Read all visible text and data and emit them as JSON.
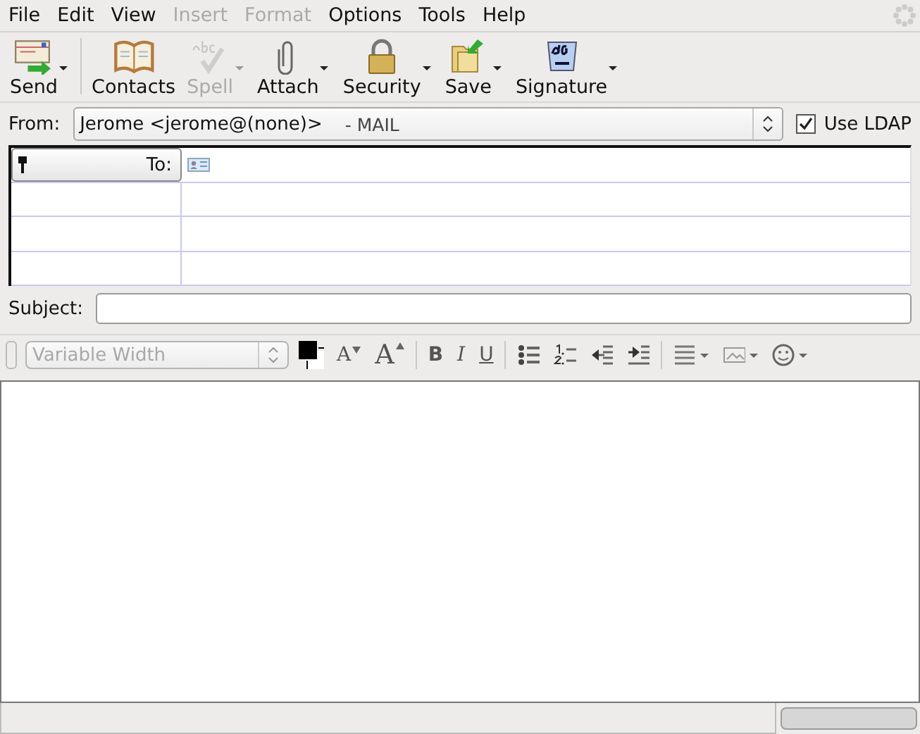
{
  "menu": [
    {
      "label": "File",
      "disabled": false
    },
    {
      "label": "Edit",
      "disabled": false
    },
    {
      "label": "View",
      "disabled": false
    },
    {
      "label": "Insert",
      "disabled": true
    },
    {
      "label": "Format",
      "disabled": true
    },
    {
      "label": "Options",
      "disabled": false
    },
    {
      "label": "Tools",
      "disabled": false
    },
    {
      "label": "Help",
      "disabled": false
    }
  ],
  "toolbar": [
    {
      "label": "Send",
      "disabled": false,
      "has_menu": true
    },
    {
      "label": "Contacts",
      "disabled": false,
      "has_menu": false
    },
    {
      "label": "Spell",
      "disabled": true,
      "has_menu": true
    },
    {
      "label": "Attach",
      "disabled": false,
      "has_menu": true
    },
    {
      "label": "Security",
      "disabled": false,
      "has_menu": true
    },
    {
      "label": "Save",
      "disabled": false,
      "has_menu": true
    },
    {
      "label": "Signature",
      "disabled": false,
      "has_menu": true
    }
  ],
  "from": {
    "label": "From:",
    "value": "Jerome <jerome@(none)>",
    "account": "- MAIL"
  },
  "use_ldap": {
    "label": "Use LDAP",
    "checked": true
  },
  "addresses": [
    {
      "kind": "recipient",
      "type": "To:"
    },
    {
      "kind": "blank"
    },
    {
      "kind": "blank"
    },
    {
      "kind": "blank"
    }
  ],
  "subject": {
    "label": "Subject:"
  },
  "format": {
    "paragraph": "Variable Width",
    "disabled": true,
    "buttons": [
      {
        "kind": "smaller",
        "label": "A"
      },
      {
        "kind": "larger",
        "label": "A"
      },
      {
        "kind": "sep"
      },
      {
        "kind": "bold",
        "label": "B"
      },
      {
        "kind": "italic",
        "label": "I"
      },
      {
        "kind": "underline",
        "label": "U"
      },
      {
        "kind": "sep"
      },
      {
        "kind": "bullets"
      },
      {
        "kind": "numbers"
      },
      {
        "kind": "outdent"
      },
      {
        "kind": "indent"
      },
      {
        "kind": "sep"
      },
      {
        "kind": "align"
      },
      {
        "kind": "image"
      },
      {
        "kind": "smiley"
      }
    ]
  },
  "status_bar": {
    "progress": {
      "level": 0
    }
  }
}
